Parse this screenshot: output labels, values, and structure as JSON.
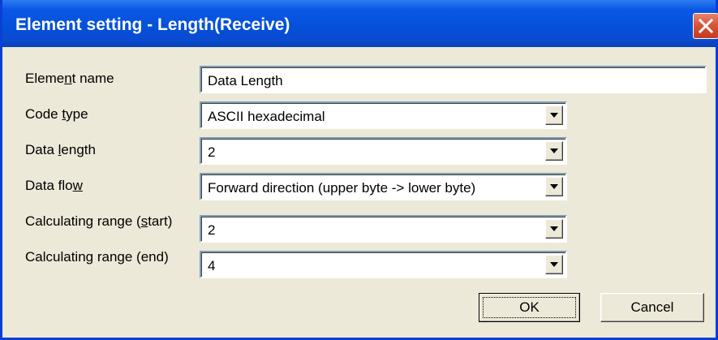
{
  "window": {
    "title": "Element setting - Length(Receive)"
  },
  "form": {
    "element_name": {
      "label_before": "Eleme",
      "label_underline": "n",
      "label_after": "t name",
      "value": "Data Length"
    },
    "code_type": {
      "label_before": "Code ",
      "label_underline": "t",
      "label_after": "ype",
      "value": "ASCII hexadecimal"
    },
    "data_length": {
      "label_before": "Data ",
      "label_underline": "l",
      "label_after": "ength",
      "value": "2"
    },
    "data_flow": {
      "label_before": "Data flo",
      "label_underline": "w",
      "label_after": "",
      "value": "Forward direction (upper byte -> lower byte)"
    },
    "calc_start": {
      "label_before": "Calculating range (",
      "label_underline": "s",
      "label_after": "tart)",
      "value": "2"
    },
    "calc_end": {
      "label_before": "Calculating ran",
      "label_underline": "g",
      "label_after": "e (end)",
      "value": "4"
    }
  },
  "buttons": {
    "ok": "OK",
    "cancel": "Cancel"
  },
  "colors": {
    "titlebar": "#0450d8",
    "dialog_bg": "#ece9d8",
    "close_button": "#d9553a"
  }
}
